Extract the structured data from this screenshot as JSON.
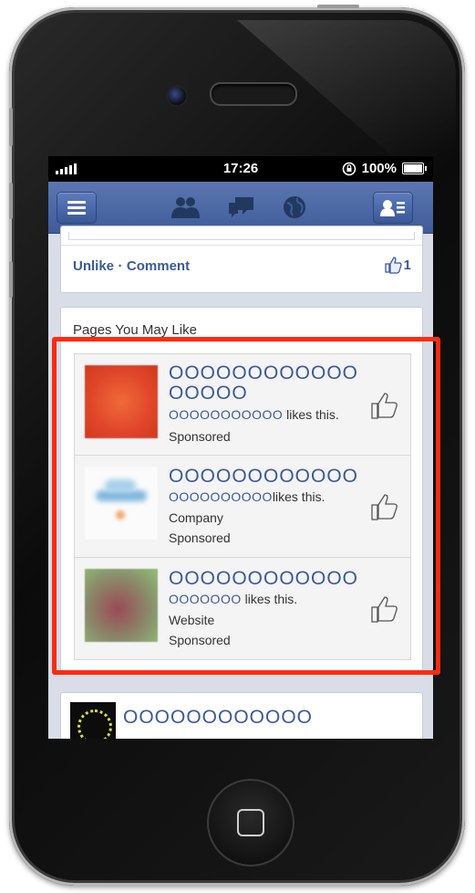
{
  "status_bar": {
    "time": "17:26",
    "battery": "100%"
  },
  "post_actions": {
    "unlike": "Unlike",
    "separator": "·",
    "comment": "Comment",
    "like_count": "1"
  },
  "pages_section": {
    "title": "Pages You May Like",
    "items": [
      {
        "name_line1": "OOOOOOOOOOOO",
        "name_line2": "OOOOO",
        "likes_name": "OOOOOOOOOOO",
        "likes_suffix": " likes this.",
        "category": "",
        "sponsored": "Sponsored"
      },
      {
        "name_line1": "OOOOOOOOOOOO",
        "name_line2": "",
        "likes_name": "OOOOOOOOOO",
        "likes_suffix": "likes this.",
        "category": "Company",
        "sponsored": "Sponsored"
      },
      {
        "name_line1": "OOOOOOOOOOOO",
        "name_line2": "",
        "likes_name": "OOOOOOO",
        "likes_suffix": " likes this.",
        "category": "Website",
        "sponsored": "Sponsored"
      }
    ]
  },
  "next_post": {
    "name": "OOOOOOOOOOOO"
  },
  "colors": {
    "facebook_blue": "#3b5998",
    "highlight": "#ff2a10"
  }
}
